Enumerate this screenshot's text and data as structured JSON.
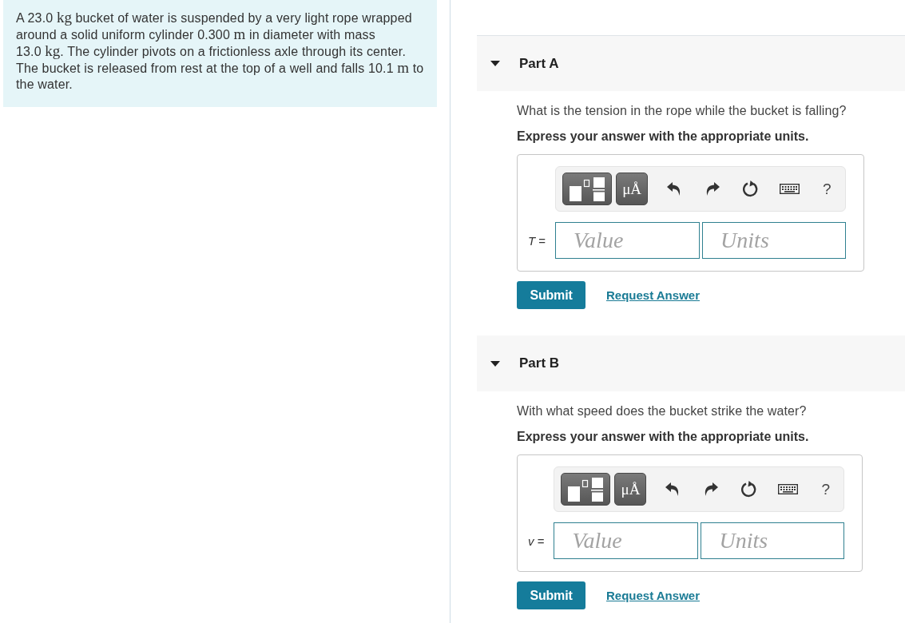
{
  "problem": {
    "segments": [
      {
        "kind": "text",
        "text": "A "
      },
      {
        "kind": "quantity",
        "value": "23.0",
        "unit": "kg"
      },
      {
        "kind": "text",
        "text": " bucket of water is suspended by a very light rope wrapped around a solid uniform cylinder "
      },
      {
        "kind": "quantity",
        "value": "0.300",
        "unit": "m"
      },
      {
        "kind": "text",
        "text": " in diameter with mass "
      },
      {
        "kind": "quantity",
        "value": "13.0",
        "unit": "kg"
      },
      {
        "kind": "text",
        "text": ". The cylinder pivots on a frictionless axle through its center. The bucket is released from rest at the top of a well and falls "
      },
      {
        "kind": "quantity",
        "value": "10.1",
        "unit": "m"
      },
      {
        "kind": "text",
        "text": " to the water."
      }
    ]
  },
  "parts": [
    {
      "title": "Part A",
      "expanded": true,
      "question": "What is the tension in the rope while the bucket is falling?",
      "instruction": "Express your answer with the appropriate units.",
      "toolbar": [
        {
          "kind": "templates"
        },
        {
          "kind": "symbols",
          "label": "μÅ"
        },
        {
          "kind": "undo"
        },
        {
          "kind": "redo"
        },
        {
          "kind": "reset"
        },
        {
          "kind": "keyboard"
        },
        {
          "kind": "help",
          "label": "?"
        }
      ],
      "answer": {
        "label": "*T* =",
        "value_placeholder": "Value",
        "units_placeholder": "Units"
      },
      "submit": "Submit",
      "request_answer": "Request Answer"
    },
    {
      "title": "Part B",
      "expanded": true,
      "question": "With what speed does the bucket strike the water?",
      "instruction": "Express your answer with the appropriate units.",
      "toolbar": [
        {
          "kind": "templates"
        },
        {
          "kind": "symbols",
          "label": "μÅ"
        },
        {
          "kind": "undo"
        },
        {
          "kind": "redo"
        },
        {
          "kind": "reset"
        },
        {
          "kind": "keyboard"
        },
        {
          "kind": "help",
          "label": "?"
        }
      ],
      "answer": {
        "label": "*v* =",
        "value_placeholder": "Value",
        "units_placeholder": "Units"
      },
      "submit": "Submit",
      "request_answer": "Request Answer"
    }
  ]
}
